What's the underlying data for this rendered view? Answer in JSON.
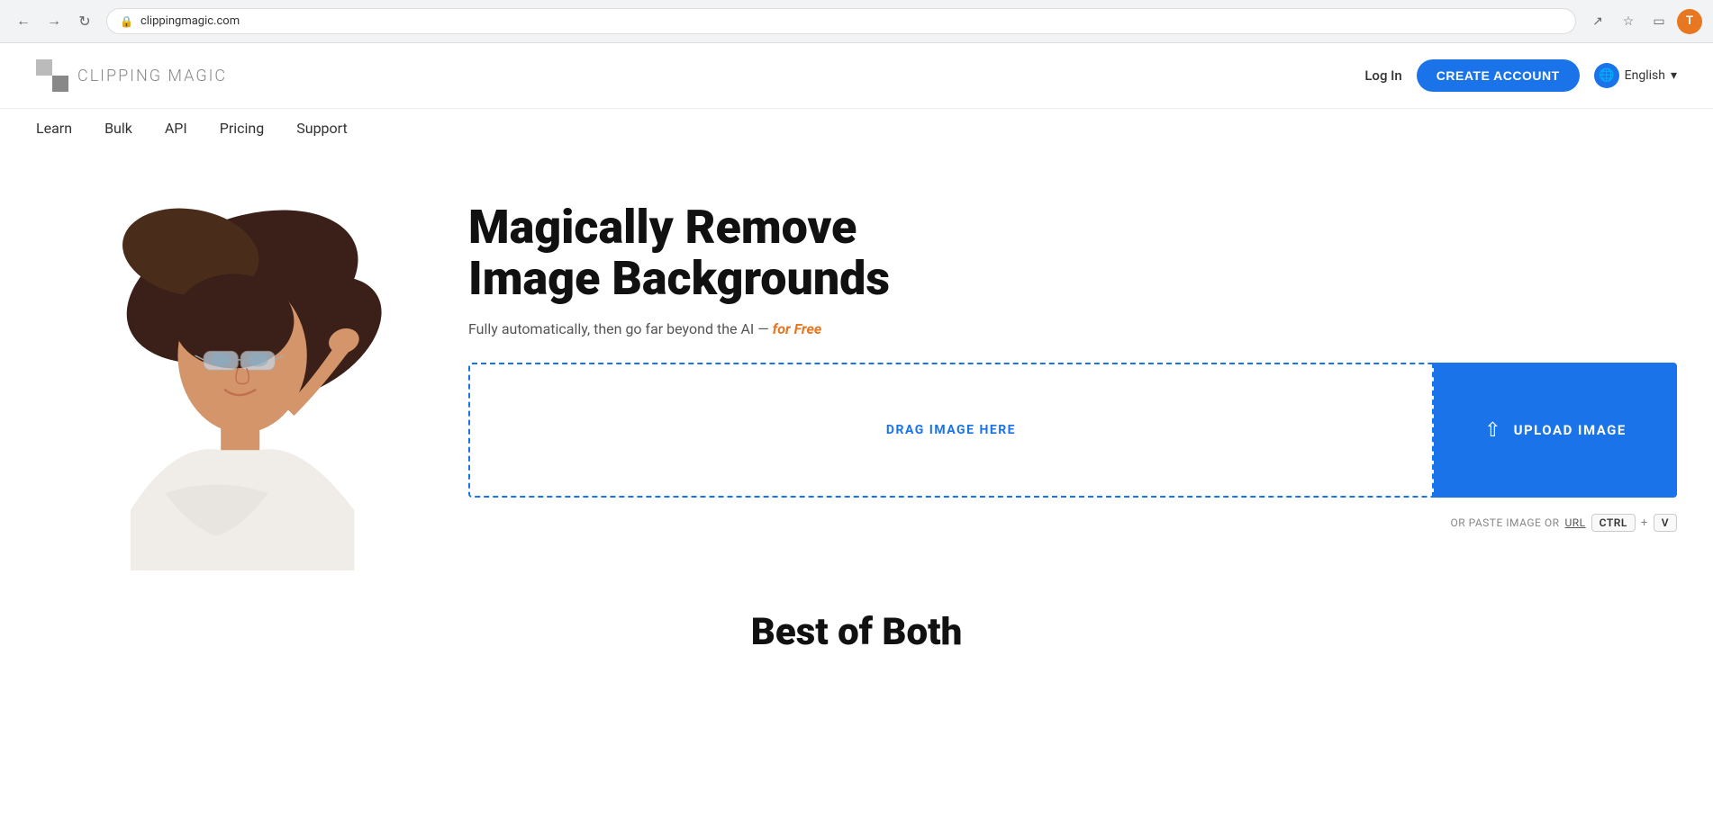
{
  "browser": {
    "url": "clippingmagic.com",
    "back_title": "Back",
    "forward_title": "Forward",
    "reload_title": "Reload",
    "user_initial": "T"
  },
  "header": {
    "logo_bold": "CLIPPING",
    "logo_light": " MAGIC",
    "login_label": "Log In",
    "create_account_label": "CREATE ACCOUNT",
    "language_label": "English",
    "language_chevron": "▾"
  },
  "nav": {
    "items": [
      {
        "label": "Learn",
        "id": "learn"
      },
      {
        "label": "Bulk",
        "id": "bulk"
      },
      {
        "label": "API",
        "id": "api"
      },
      {
        "label": "Pricing",
        "id": "pricing"
      },
      {
        "label": "Support",
        "id": "support"
      }
    ]
  },
  "hero": {
    "heading_line1": "Magically Remove",
    "heading_line2": "Image Backgrounds",
    "subtext_before": "Fully automatically, then go far beyond the AI — ",
    "subtext_free": "for Free",
    "drag_label": "DRAG IMAGE HERE",
    "upload_label": "UPLOAD IMAGE",
    "paste_before": "OR PASTE IMAGE OR",
    "paste_url": "URL",
    "ctrl_key": "CTRL",
    "plus_sign": "+",
    "v_key": "V"
  },
  "bottom": {
    "heading": "Best of Both"
  }
}
